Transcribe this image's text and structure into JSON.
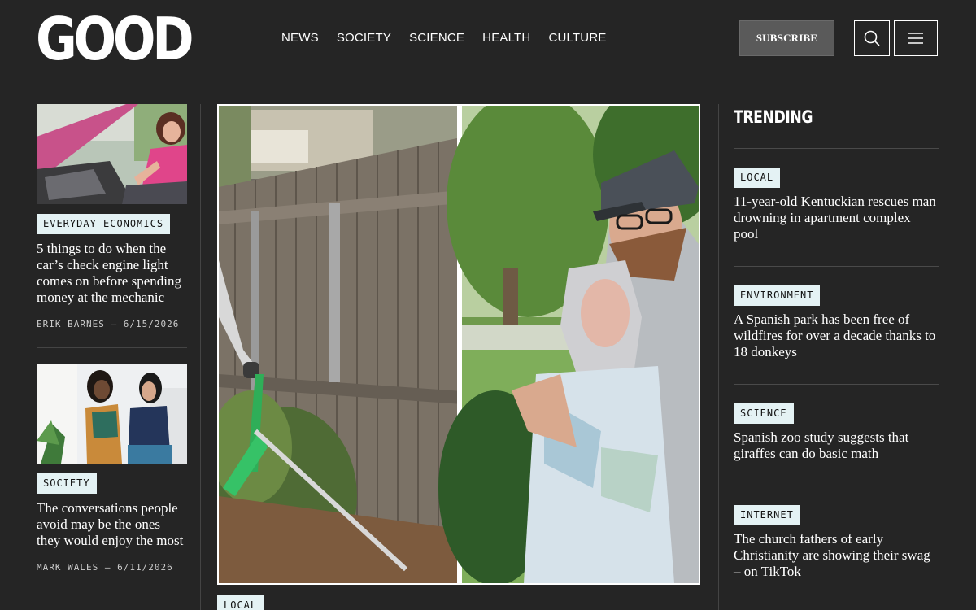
{
  "header": {
    "logo": "GOOD",
    "nav": [
      "NEWS",
      "SOCIETY",
      "SCIENCE",
      "HEALTH",
      "CULTURE"
    ],
    "subscribe_label": "SUBSCRIBE",
    "search_icon": "search-icon",
    "menu_icon": "hamburger-menu-icon"
  },
  "left_stories": [
    {
      "tag": "EVERYDAY ECONOMICS",
      "title": "5 things to do when the car’s check engine light comes on before spending money at the mechanic",
      "byline": "ERIK BARNES – 6/15/2026"
    },
    {
      "tag": "SOCIETY",
      "title": "The conversations people avoid may be the ones they would enjoy the most",
      "byline": "MARK WALES – 6/11/2026"
    }
  ],
  "feature": {
    "tag": "LOCAL"
  },
  "trending": {
    "title": "TRENDING",
    "items": [
      {
        "tag": "LOCAL",
        "title": "11-year-old Kentuckian rescues man drowning in apartment complex pool"
      },
      {
        "tag": "ENVIRONMENT",
        "title": "A Spanish park has been free of wildfires for over a decade thanks to 18 donkeys"
      },
      {
        "tag": "SCIENCE",
        "title": "Spanish zoo study suggests that giraffes can do basic math"
      },
      {
        "tag": "INTERNET",
        "title": "The church fathers of early Christianity are showing their swag – on TikTok"
      }
    ]
  },
  "colors": {
    "background": "#252525",
    "tag_bg": "#e4f2f4",
    "subscribe_bg": "#5a5a5a"
  }
}
